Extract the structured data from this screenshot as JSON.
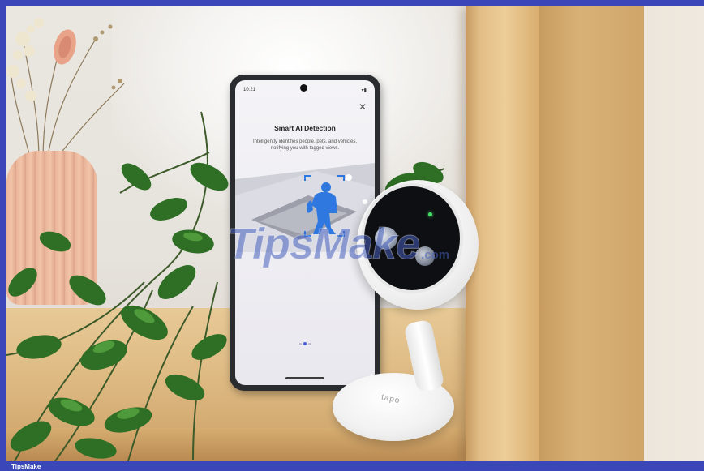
{
  "footer": {
    "brand": "TipsMake"
  },
  "watermark": {
    "main": "TipsMake",
    "suffix": ".com"
  },
  "phone": {
    "status_time": "10:21",
    "close_glyph": "✕",
    "screen_title": "Smart AI Detection",
    "screen_description": "Intelligently identifies people, pets, and vehicles, notifying you with tagged views.",
    "carousel": {
      "total": 3,
      "active": 2
    }
  },
  "camera": {
    "brand": "tapo"
  },
  "colors": {
    "border": "#3b47b8",
    "accent_blue": "#2f78e0",
    "led_green": "#46e06a"
  }
}
